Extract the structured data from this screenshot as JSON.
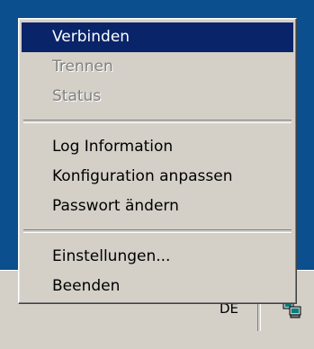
{
  "menu": {
    "items": [
      {
        "label": "Verbinden",
        "state": "highlighted"
      },
      {
        "label": "Trennen",
        "state": "disabled"
      },
      {
        "label": "Status",
        "state": "disabled"
      },
      {
        "label": "Log Information",
        "state": "enabled"
      },
      {
        "label": "Konfiguration anpassen",
        "state": "enabled"
      },
      {
        "label": "Passwort ändern",
        "state": "enabled"
      },
      {
        "label": "Einstellungen...",
        "state": "enabled"
      },
      {
        "label": "Beenden",
        "state": "enabled"
      }
    ]
  },
  "tray": {
    "language": "DE",
    "icon": "network-computers-icon"
  },
  "colors": {
    "desktop": "#0b4f8e",
    "menu_background": "#d4d0c8",
    "highlight": "#0a246a",
    "disabled_text": "#808080"
  }
}
